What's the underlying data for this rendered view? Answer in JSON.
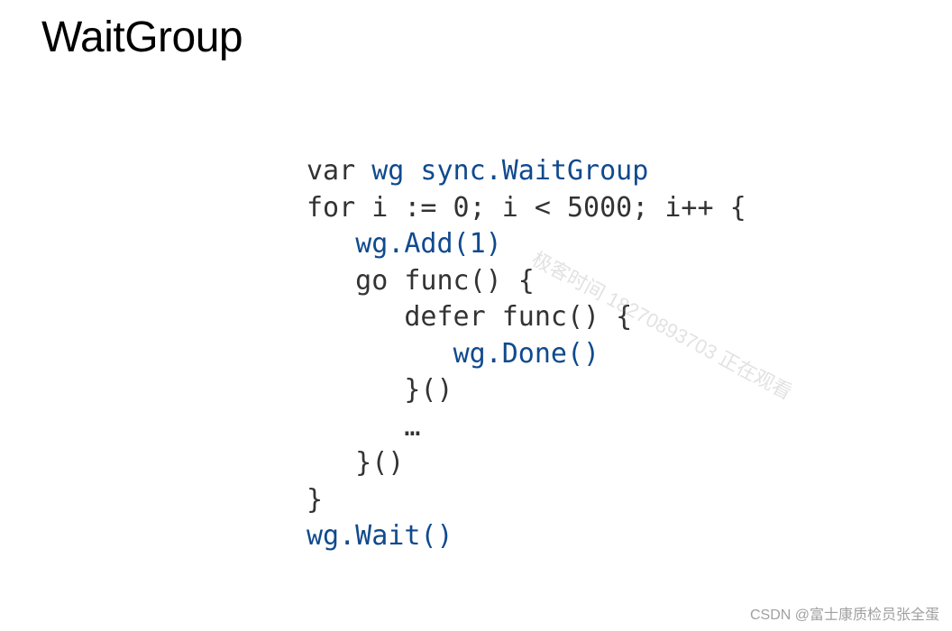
{
  "title": "WaitGroup",
  "code": {
    "line1_pre": "var ",
    "line1_mid": "wg sync.WaitGroup",
    "line2": "for i := 0; i < 5000; i++ {",
    "line3_indent": "   ",
    "line3_call": "wg.Add(1)",
    "line4": "   go func() {",
    "line5": "      defer func() {",
    "line6_indent": "         ",
    "line6_call": "wg.Done()",
    "line7": "      }()",
    "line8": "      …",
    "line9": "   }()",
    "line10": "}",
    "line11": "wg.Wait()"
  },
  "watermark_diag": "极客时间 18270893703 正在观看",
  "watermark_footer": "CSDN @富士康质检员张全蛋"
}
